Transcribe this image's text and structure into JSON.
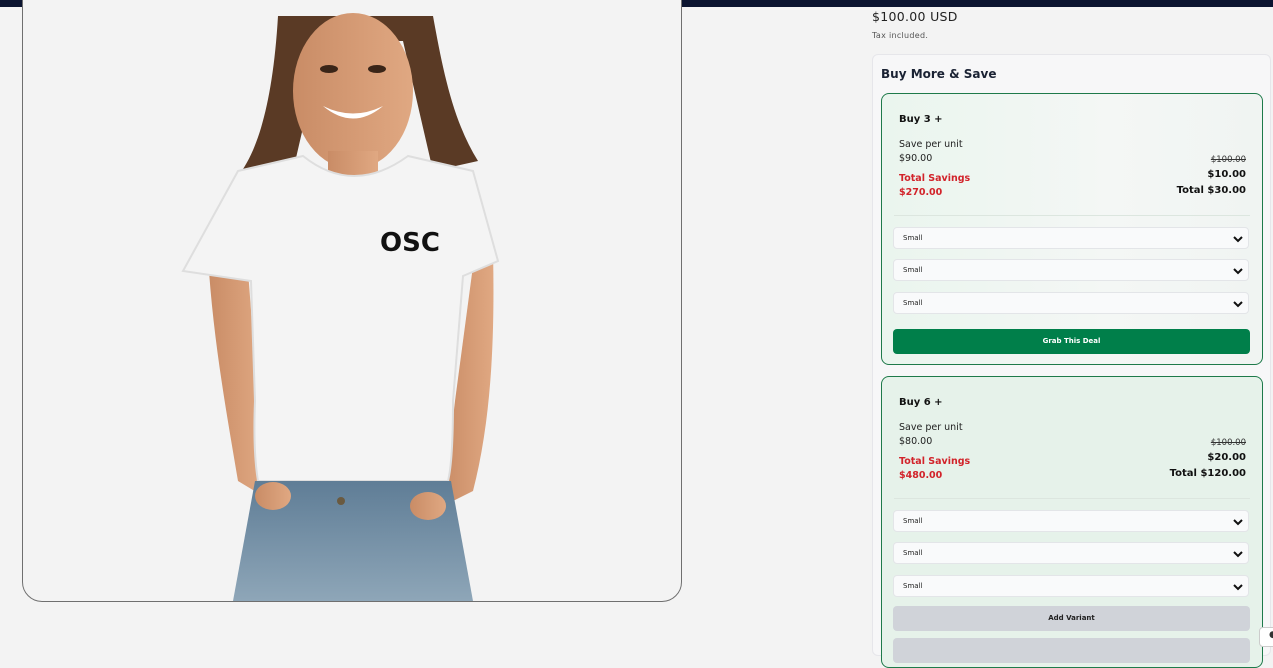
{
  "product": {
    "price": "$100.00 USD",
    "tax_note": "Tax included."
  },
  "product_image": {
    "logo_text": "OSC"
  },
  "promo": {
    "title": "Buy More & Save",
    "offers": [
      {
        "name": "Buy 3 +",
        "save_label": "Save per unit",
        "unit_price": "$90.00",
        "total_savings_label": "Total Savings",
        "total_savings": "$270.00",
        "original_price": "$100.00",
        "save_amount": "$10.00",
        "total": "Total $30.00",
        "variants": [
          "Small",
          "Small",
          "Small"
        ],
        "button": "Grab This Deal"
      },
      {
        "name": "Buy 6 +",
        "save_label": "Save per unit",
        "unit_price": "$80.00",
        "total_savings_label": "Total Savings",
        "total_savings": "$480.00",
        "original_price": "$100.00",
        "save_amount": "$20.00",
        "total": "Total $120.00",
        "variants": [
          "Small",
          "Small",
          "Small"
        ],
        "button": "Add Variant"
      }
    ]
  },
  "colors": {
    "accent_green": "#007f4a",
    "savings_red": "#d2232a",
    "top_bar": "#0b1430"
  },
  "icons": {
    "select_chevron": "chevron-down-icon"
  }
}
